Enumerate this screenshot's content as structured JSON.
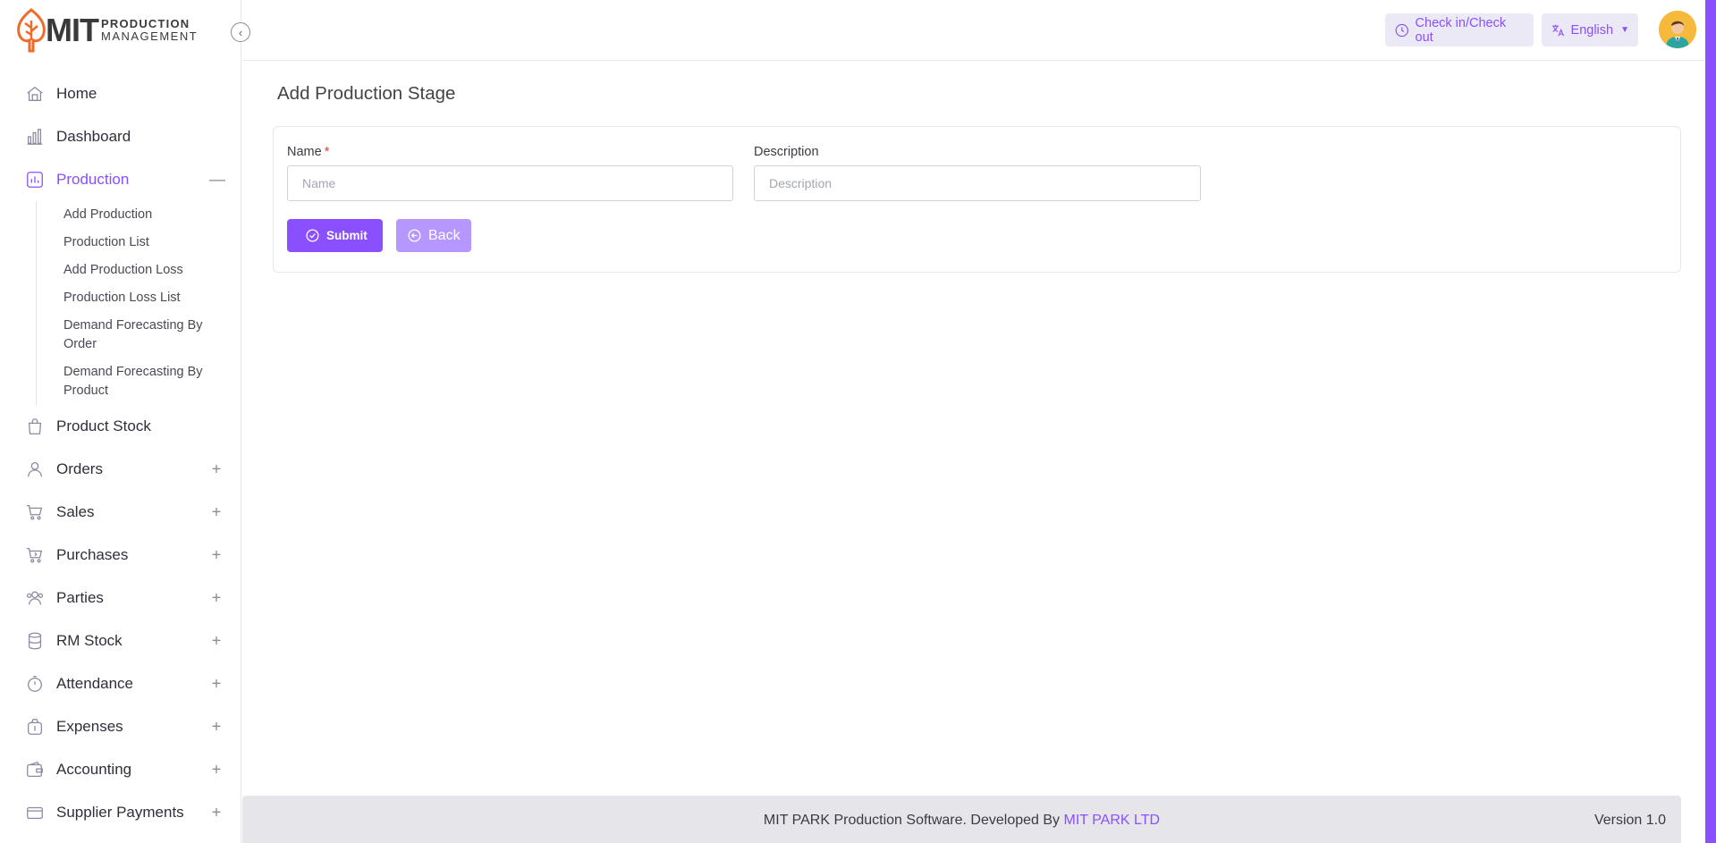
{
  "brand": {
    "logo_main": "MIT",
    "logo_line1": "PRODUCTION",
    "logo_line2": "MANAGEMENT",
    "accent_color": "#8a4fff",
    "logo_color": "#f06a2a"
  },
  "sidebar": {
    "items": [
      {
        "label": "Home",
        "icon": "home-icon"
      },
      {
        "label": "Dashboard",
        "icon": "bar-chart-icon"
      },
      {
        "label": "Production",
        "icon": "chart-box-icon",
        "expanded": true
      },
      {
        "label": "Product Stock",
        "icon": "bag-icon"
      },
      {
        "label": "Orders",
        "icon": "user-icon"
      },
      {
        "label": "Sales",
        "icon": "cart-icon"
      },
      {
        "label": "Purchases",
        "icon": "cart-arrow-icon"
      },
      {
        "label": "Parties",
        "icon": "users-icon"
      },
      {
        "label": "RM Stock",
        "icon": "database-icon"
      },
      {
        "label": "Attendance",
        "icon": "stopwatch-icon"
      },
      {
        "label": "Expenses",
        "icon": "money-bag-icon"
      },
      {
        "label": "Accounting",
        "icon": "wallet-icon"
      },
      {
        "label": "Supplier Payments",
        "icon": "card-icon"
      }
    ],
    "production_sub": [
      "Add Production",
      "Production List",
      "Add Production Loss",
      "Production Loss List",
      "Demand Forecasting By Order",
      "Demand Forecasting By Product"
    ],
    "expand_symbol": "+",
    "collapse_symbol": "—"
  },
  "header": {
    "checkin_label": "Check in/Check out",
    "language_label": "English"
  },
  "main": {
    "title": "Add Production Stage",
    "name_label": "Name",
    "required_mark": "*",
    "name_placeholder": "Name",
    "description_label": "Description",
    "description_placeholder": "Description",
    "submit_label": "Submit",
    "back_label": "Back"
  },
  "footer": {
    "text": "MIT PARK Production Software. Developed By ",
    "link": "MIT PARK LTD",
    "version": "Version 1.0"
  }
}
